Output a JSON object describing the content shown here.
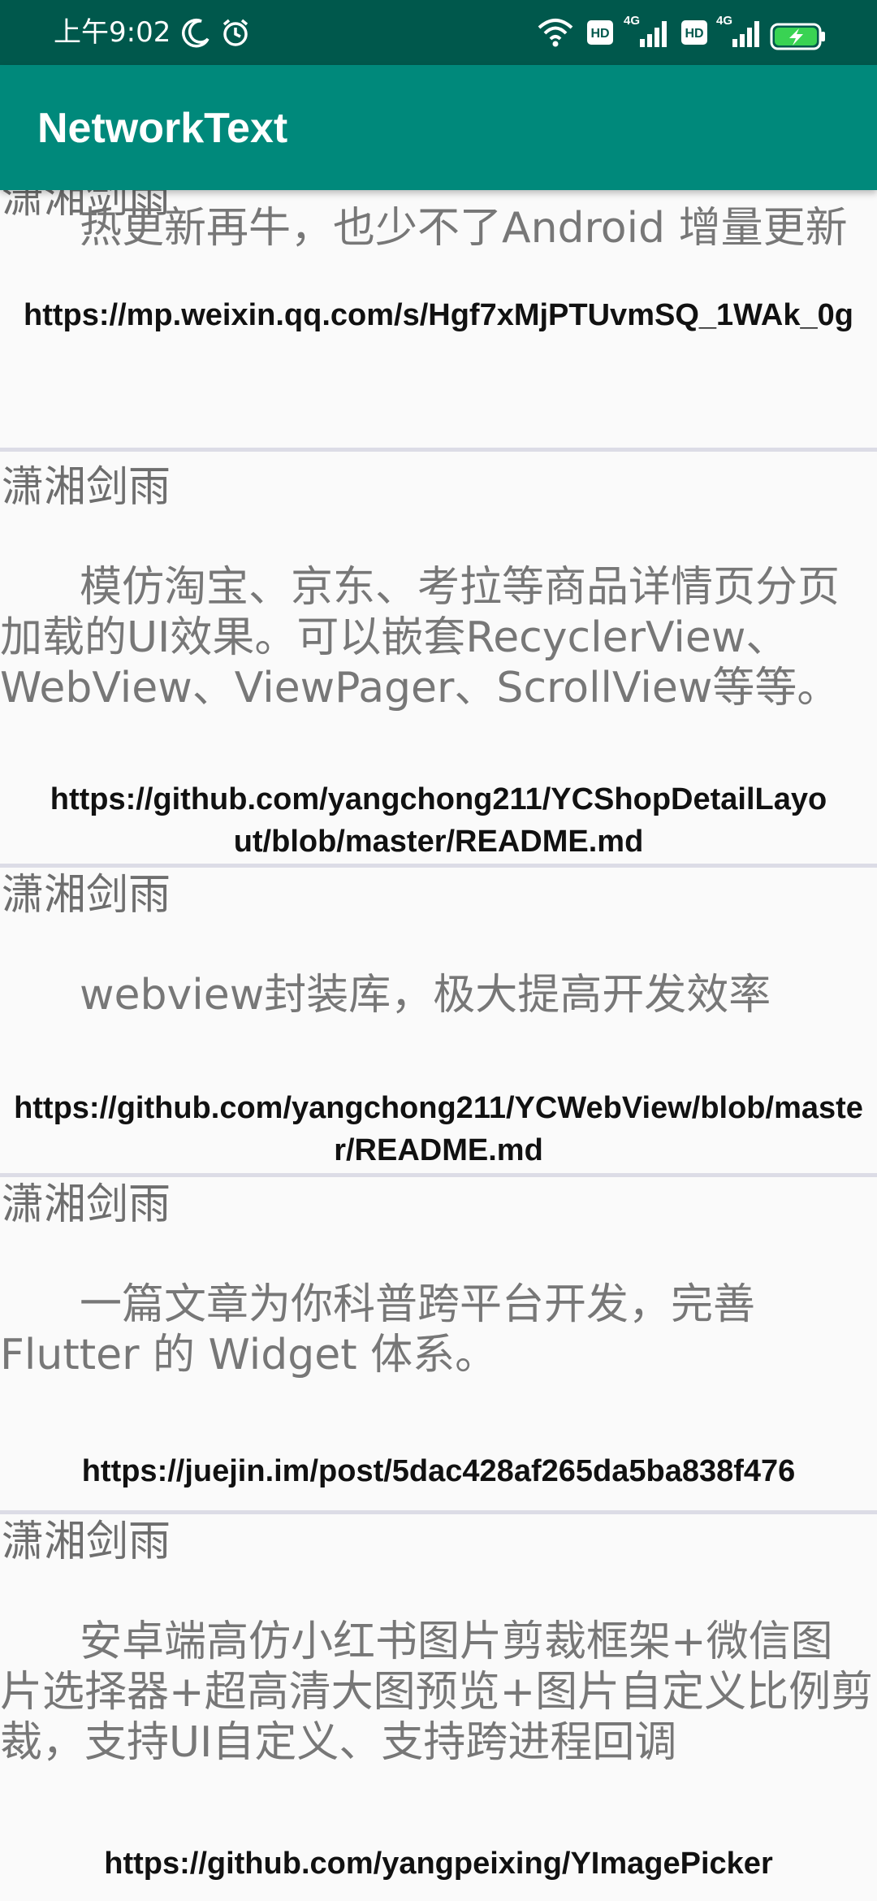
{
  "status_bar": {
    "time": "上午9:02",
    "icons": [
      "moon-icon",
      "alarm-icon",
      "wifi-icon",
      "hd-icon",
      "signal-4g-icon",
      "hd-icon",
      "signal-4g-icon",
      "battery-charging-icon"
    ],
    "hd_label": "HD",
    "network_label": "4G"
  },
  "app_bar": {
    "title": "NetworkText",
    "color": "#00897b"
  },
  "items": [
    {
      "author": "潇湘剑雨",
      "desc": "热更新再牛，也少不了Android 增量更新",
      "link": "https://mp.weixin.qq.com/s/Hgf7xMjPTUvmSQ_1WAk_0g"
    },
    {
      "author": "潇湘剑雨",
      "desc": "模仿淘宝、京东、考拉等商品详情页分页加载的UI效果。可以嵌套RecyclerView、WebView、ViewPager、ScrollView等等。",
      "link": "https://github.com/yangchong211/YCShopDetailLayout/blob/master/README.md"
    },
    {
      "author": "潇湘剑雨",
      "desc": "webview封装库，极大提高开发效率",
      "link": "https://github.com/yangchong211/YCWebView/blob/master/README.md"
    },
    {
      "author": "潇湘剑雨",
      "desc": "一篇文章为你科普跨平台开发，完善Flutter 的 Widget 体系。",
      "link": "https://juejin.im/post/5dac428af265da5ba838f476"
    },
    {
      "author": "潇湘剑雨",
      "desc": "安卓端高仿小红书图片剪裁框架+微信图片选择器+超高清大图预览+图片自定义比例剪裁，支持UI自定义、支持跨进程回调",
      "link": "https://github.com/yangpeixing/YImagePicker"
    }
  ]
}
